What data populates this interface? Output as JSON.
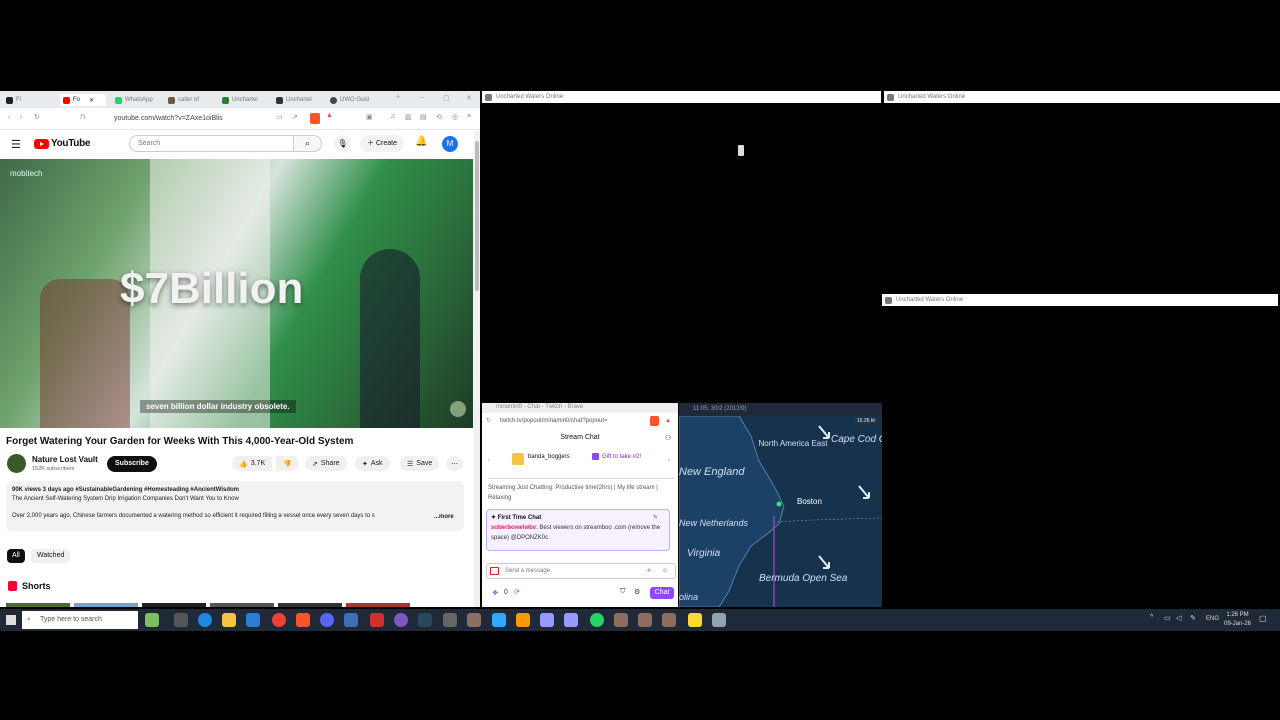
{
  "browser": {
    "tabs": [
      {
        "label": "Fi",
        "color": "#202124"
      },
      {
        "label": "Fo",
        "color": "#ff0000"
      },
      {
        "label": "WhatsApp",
        "color": "#25d366"
      },
      {
        "label": "caller of",
        "color": "#6c5a3f"
      },
      {
        "label": "Unchartel",
        "color": "#2e7d32"
      },
      {
        "label": "Unchartel",
        "color": "#333333"
      },
      {
        "label": "UWO Guid",
        "color": "#444444"
      }
    ],
    "url": "youtube.com/watch?v=ZAxe1oiBlis"
  },
  "youtube": {
    "logo_text": "YouTube",
    "search_placeholder": "Search",
    "create_label": "Create",
    "avatar_letter": "M",
    "video_overlay_text": "$7Billion",
    "video_watermark": "mobitech",
    "caption": "seven billion dollar industry obsolete.",
    "title": "Forget Watering Your Garden for Weeks With This 4,000-Year-Old System",
    "channel_name": "Nature Lost Vault",
    "subscribers": "152K subscribers",
    "subscribe_label": "Subscribe",
    "likes": "3.7K",
    "share_label": "Share",
    "ask_label": "Ask",
    "save_label": "Save",
    "meta": "90K views  3 days ago  #SustainableGardening #Homesteading #AncientWisdom",
    "desc_line1": "The Ancient Self-Watering System Drip Irrigation Companies Don't Want You to Know",
    "desc_line2": "Over 2,000 years ago, Chinese farmers documented a watering method so efficient it required filling a vessel once every seven days to s",
    "more_label": "...more",
    "filter_all": "All",
    "filter_watched": "Watched",
    "shorts_label": "Shorts"
  },
  "uncharted": {
    "window_title": "Uncharted Waters Online"
  },
  "twitch": {
    "window_title": "minamin0 - Chat - Twitch - Brave",
    "url": "twitch.tv/popout/minamin0/chat?popout=",
    "chat_header": "Stream Chat",
    "pinned_user": "banda_boggers",
    "pinned_gift": "Gift to take #2!",
    "stream_info": "Streaming Just Chatting: Productive time(2hrs) | My life stream | Relaxing",
    "ftc_label": "First Time Chat",
    "ftc_user": "soberbowelwbv",
    "ftc_message": ": Best viewers on streamboo .com (remove the space) @DPONZK0c",
    "input_placeholder": "Send a message",
    "points": "0",
    "chat_button": "Chat"
  },
  "map": {
    "title_text": "11:05, 30/2 (2012/9)",
    "coord_text": "16.26 kt",
    "labels": [
      "North America East",
      "Cape Cod Open Sea",
      "New England",
      "Boston",
      "New Netherlands",
      "Virginia",
      "Bermuda Open Sea",
      "olina"
    ]
  },
  "taskbar": {
    "search_placeholder": "Type here to search",
    "time": "1:26 PM",
    "date": "09-Jan-26",
    "lang": "ENG"
  }
}
